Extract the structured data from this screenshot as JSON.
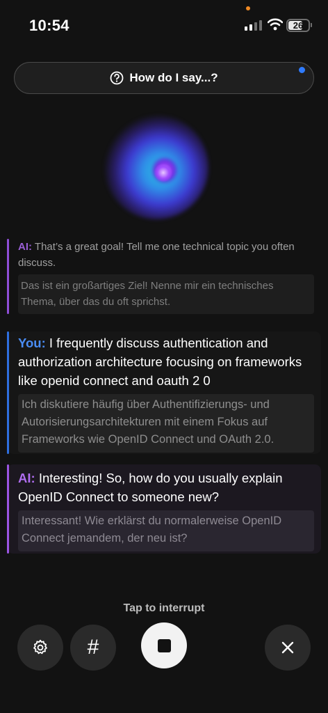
{
  "status_bar": {
    "time": "10:54",
    "battery": "26"
  },
  "help": {
    "label": "How do I say...?"
  },
  "messages": [
    {
      "speaker": "AI:",
      "text": "That’s a great goal! Tell me one technical topic you often discuss.",
      "translation": "Das ist ein großartiges Ziel! Nenne mir ein technisches Thema, über das du oft sprichst."
    },
    {
      "speaker": "You:",
      "text": "I frequently discuss authentication and authorization architecture focusing on frameworks like openid connect and oauth 2 0",
      "translation": "Ich diskutiere häufig über Authentifizierungs- und Autorisierungsarchitekturen mit einem Fokus auf Frameworks wie OpenID Connect und OAuth 2.0."
    },
    {
      "speaker": "AI:",
      "text": "Interesting! So, how do you usually explain OpenID Connect to someone new?",
      "translation": "Interessant! Wie erklärst du normalerweise OpenID Connect jemandem, der neu ist?"
    }
  ],
  "controls": {
    "hint": "Tap to interrupt",
    "hash_label": "#"
  },
  "colors": {
    "ai_accent": "#9b55e3",
    "user_accent": "#2e6fe0",
    "notification_dot": "#2f7bff"
  }
}
